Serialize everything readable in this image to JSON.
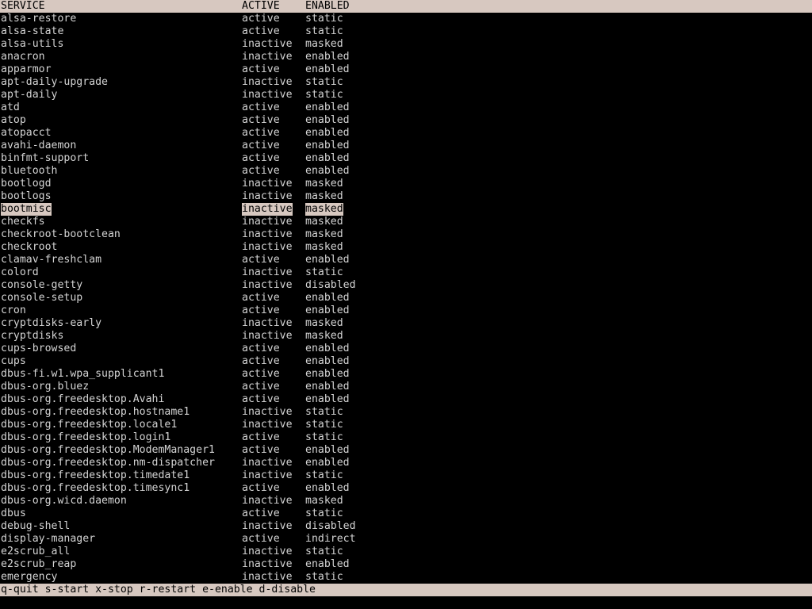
{
  "colors": {
    "background": "#000000",
    "foreground": "#d4d4d4",
    "bar": "#d7c8c0",
    "bar_text": "#000000"
  },
  "header": {
    "service": "SERVICE",
    "active": "ACTIVE",
    "enabled": "ENABLED"
  },
  "selected_index": 16,
  "services": [
    {
      "name": "alsa-restore",
      "active": "active",
      "enabled": "static"
    },
    {
      "name": "alsa-state",
      "active": "active",
      "enabled": "static"
    },
    {
      "name": "alsa-utils",
      "active": "inactive",
      "enabled": "masked"
    },
    {
      "name": "anacron",
      "active": "inactive",
      "enabled": "enabled"
    },
    {
      "name": "apparmor",
      "active": "active",
      "enabled": "enabled"
    },
    {
      "name": "apt-daily-upgrade",
      "active": "inactive",
      "enabled": "static"
    },
    {
      "name": "apt-daily",
      "active": "inactive",
      "enabled": "static"
    },
    {
      "name": "atd",
      "active": "active",
      "enabled": "enabled"
    },
    {
      "name": "atop",
      "active": "active",
      "enabled": "enabled"
    },
    {
      "name": "atopacct",
      "active": "active",
      "enabled": "enabled"
    },
    {
      "name": "avahi-daemon",
      "active": "active",
      "enabled": "enabled"
    },
    {
      "name": "binfmt-support",
      "active": "active",
      "enabled": "enabled"
    },
    {
      "name": "bluetooth",
      "active": "active",
      "enabled": "enabled"
    },
    {
      "name": "bootlogd",
      "active": "inactive",
      "enabled": "masked"
    },
    {
      "name": "bootlogs",
      "active": "inactive",
      "enabled": "masked"
    },
    {
      "name": "bootmisc",
      "active": "inactive",
      "enabled": "masked"
    },
    {
      "name": "checkfs",
      "active": "inactive",
      "enabled": "masked"
    },
    {
      "name": "checkroot-bootclean",
      "active": "inactive",
      "enabled": "masked"
    },
    {
      "name": "checkroot",
      "active": "inactive",
      "enabled": "masked"
    },
    {
      "name": "clamav-freshclam",
      "active": "active",
      "enabled": "enabled"
    },
    {
      "name": "colord",
      "active": "inactive",
      "enabled": "static"
    },
    {
      "name": "console-getty",
      "active": "inactive",
      "enabled": "disabled"
    },
    {
      "name": "console-setup",
      "active": "active",
      "enabled": "enabled"
    },
    {
      "name": "cron",
      "active": "active",
      "enabled": "enabled"
    },
    {
      "name": "cryptdisks-early",
      "active": "inactive",
      "enabled": "masked"
    },
    {
      "name": "cryptdisks",
      "active": "inactive",
      "enabled": "masked"
    },
    {
      "name": "cups-browsed",
      "active": "active",
      "enabled": "enabled"
    },
    {
      "name": "cups",
      "active": "active",
      "enabled": "enabled"
    },
    {
      "name": "dbus-fi.w1.wpa_supplicant1",
      "active": "active",
      "enabled": "enabled"
    },
    {
      "name": "dbus-org.bluez",
      "active": "active",
      "enabled": "enabled"
    },
    {
      "name": "dbus-org.freedesktop.Avahi",
      "active": "active",
      "enabled": "enabled"
    },
    {
      "name": "dbus-org.freedesktop.hostname1",
      "active": "inactive",
      "enabled": "static"
    },
    {
      "name": "dbus-org.freedesktop.locale1",
      "active": "inactive",
      "enabled": "static"
    },
    {
      "name": "dbus-org.freedesktop.login1",
      "active": "active",
      "enabled": "static"
    },
    {
      "name": "dbus-org.freedesktop.ModemManager1",
      "active": "active",
      "enabled": "enabled"
    },
    {
      "name": "dbus-org.freedesktop.nm-dispatcher",
      "active": "inactive",
      "enabled": "enabled"
    },
    {
      "name": "dbus-org.freedesktop.timedate1",
      "active": "inactive",
      "enabled": "static"
    },
    {
      "name": "dbus-org.freedesktop.timesync1",
      "active": "active",
      "enabled": "enabled"
    },
    {
      "name": "dbus-org.wicd.daemon",
      "active": "inactive",
      "enabled": "masked"
    },
    {
      "name": "dbus",
      "active": "active",
      "enabled": "static"
    },
    {
      "name": "debug-shell",
      "active": "inactive",
      "enabled": "disabled"
    },
    {
      "name": "display-manager",
      "active": "active",
      "enabled": "indirect"
    },
    {
      "name": "e2scrub_all",
      "active": "inactive",
      "enabled": "static"
    },
    {
      "name": "e2scrub_reap",
      "active": "inactive",
      "enabled": "enabled"
    },
    {
      "name": "emergency",
      "active": "inactive",
      "enabled": "static"
    }
  ],
  "footer": {
    "keys": "q-quit s-start x-stop r-restart e-enable d-disable"
  }
}
